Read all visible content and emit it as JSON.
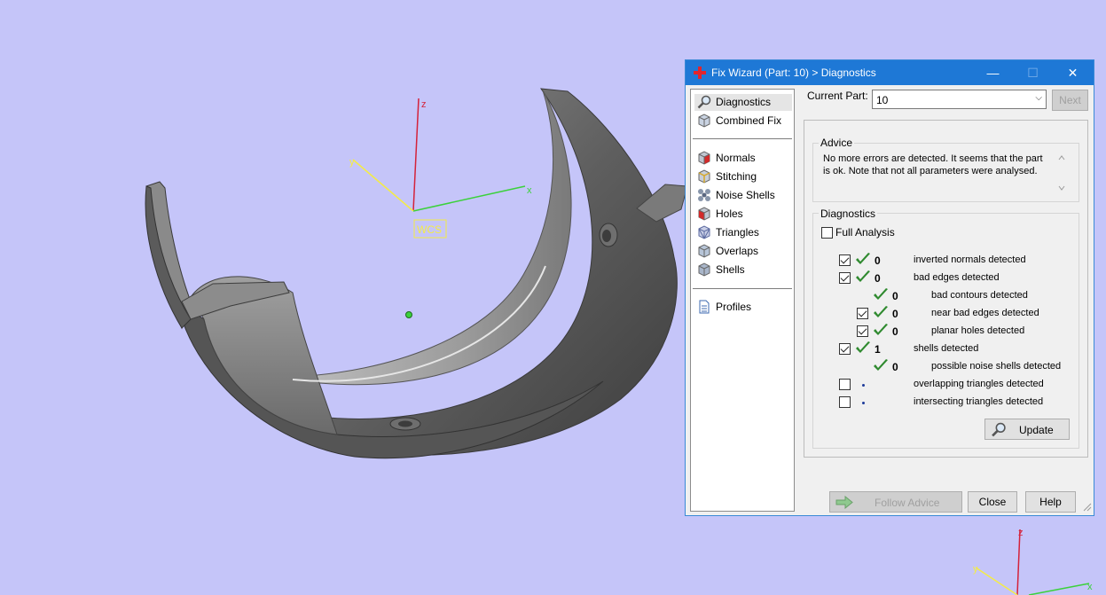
{
  "viewport": {
    "axes": {
      "x": "x",
      "y": "y",
      "z": "z"
    },
    "wcs_label": "WCS",
    "corner_axes": {
      "y": "y",
      "z": "z",
      "x": "x"
    }
  },
  "dialog": {
    "title": "Fix Wizard (Part: 10) > Diagnostics",
    "controls": {
      "minimize": "—",
      "maximize": "☐",
      "close": "✕"
    },
    "nav": {
      "top": [
        {
          "label": "Diagnostics",
          "icon": "magnifier-icon"
        },
        {
          "label": "Combined Fix",
          "icon": "cube-icon"
        }
      ],
      "fixes": [
        {
          "label": "Normals",
          "icon": "normals-cube-icon"
        },
        {
          "label": "Stitching",
          "icon": "stitching-cube-icon"
        },
        {
          "label": "Noise Shells",
          "icon": "noise-shells-icon"
        },
        {
          "label": "Holes",
          "icon": "holes-cube-icon"
        },
        {
          "label": "Triangles",
          "icon": "triangles-cube-icon"
        },
        {
          "label": "Overlaps",
          "icon": "overlaps-cube-icon"
        },
        {
          "label": "Shells",
          "icon": "shells-cube-icon"
        }
      ],
      "bottom": [
        {
          "label": "Profiles",
          "icon": "document-icon"
        }
      ]
    },
    "current_part_label": "Current Part:",
    "current_part_value": "10",
    "next_label": "Next",
    "advice": {
      "title": "Advice",
      "line1": "No more errors are detected. It seems that the part",
      "line2": "is ok. Note that not all parameters were analysed."
    },
    "diagnostics": {
      "title": "Diagnostics",
      "full_analysis_label": "Full Analysis",
      "full_analysis_checked": false,
      "rows": [
        {
          "checkbox": true,
          "checked": true,
          "status": "ok",
          "value": "0",
          "label": "inverted normals detected"
        },
        {
          "checkbox": true,
          "checked": true,
          "status": "ok",
          "value": "0",
          "label": "bad edges detected"
        },
        {
          "checkbox": false,
          "checked": false,
          "status": "ok",
          "value": "0",
          "label": "bad contours detected"
        },
        {
          "checkbox": true,
          "checked": true,
          "status": "ok",
          "value": "0",
          "label": "near bad edges detected"
        },
        {
          "checkbox": true,
          "checked": true,
          "status": "ok",
          "value": "0",
          "label": "planar holes detected"
        },
        {
          "checkbox": true,
          "checked": true,
          "status": "ok",
          "value": "1",
          "label": "shells detected"
        },
        {
          "checkbox": false,
          "checked": false,
          "status": "ok",
          "value": "0",
          "label": "possible noise shells detected"
        },
        {
          "checkbox": true,
          "checked": false,
          "status": "dot",
          "value": "",
          "label": "overlapping triangles detected"
        },
        {
          "checkbox": true,
          "checked": false,
          "status": "dot",
          "value": "",
          "label": "intersecting triangles detected"
        }
      ],
      "update_label": "Update"
    },
    "buttons": {
      "follow_advice": "Follow Advice",
      "close": "Close",
      "help": "Help"
    }
  },
  "colors": {
    "background": "#c5c5f9",
    "titlebar": "#1e78d6",
    "check_green": "#2f8a2f",
    "axis_x": "#3bd13b",
    "axis_y": "#f4ec45",
    "axis_z": "#d4223a"
  }
}
